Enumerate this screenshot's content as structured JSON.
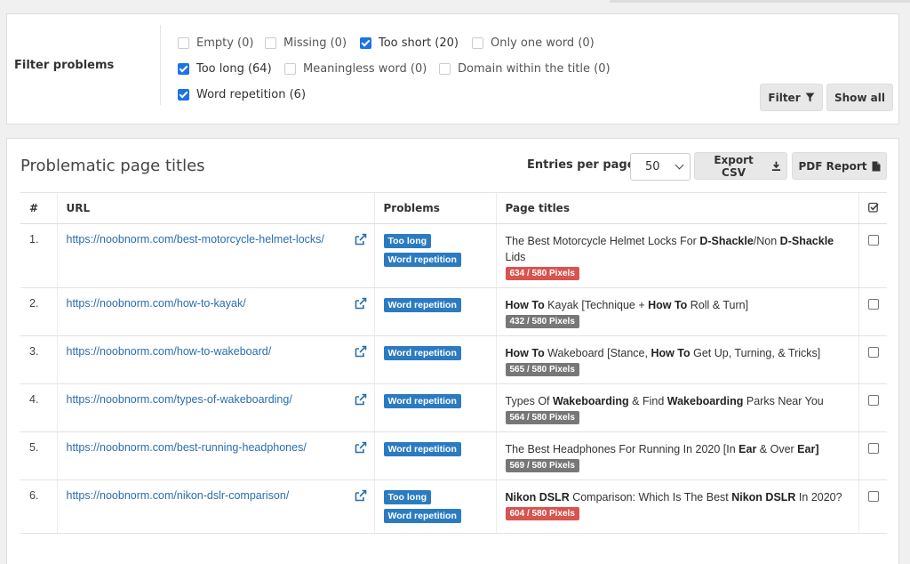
{
  "filter": {
    "title": "Filter problems",
    "options": [
      {
        "label": "Empty (0)",
        "checked": false
      },
      {
        "label": "Missing (0)",
        "checked": false
      },
      {
        "label": "Too short (20)",
        "checked": true
      },
      {
        "label": "Only one word (0)",
        "checked": false
      },
      {
        "label": "Too long (64)",
        "checked": true
      },
      {
        "label": "Meaningless word (0)",
        "checked": false
      },
      {
        "label": "Domain within the title (0)",
        "checked": false
      },
      {
        "label": "Word repetition (6)",
        "checked": true
      }
    ],
    "filter_button": "Filter",
    "show_all_button": "Show all"
  },
  "results": {
    "title": "Problematic page titles",
    "entries_label": "Entries per page:",
    "entries_value": "50",
    "export_csv": "Export CSV",
    "pdf_report": "PDF Report",
    "columns": {
      "num": "#",
      "url": "URL",
      "problems": "Problems",
      "titles": "Page titles"
    },
    "rows": [
      {
        "num": "1.",
        "url": "https://noobnorm.com/best-motorcycle-helmet-locks/",
        "problems": [
          "Too long",
          "Word repetition"
        ],
        "title_parts": [
          {
            "t": "The Best Motorcycle Helmet Locks For ",
            "b": false
          },
          {
            "t": "D-Shackle",
            "b": true
          },
          {
            "t": "/Non ",
            "b": false
          },
          {
            "t": "D-Shackle",
            "b": true
          },
          {
            "t": " Lids",
            "b": false
          }
        ],
        "pixels": "634 / 580 Pixels",
        "over": true
      },
      {
        "num": "2.",
        "url": "https://noobnorm.com/how-to-kayak/",
        "problems": [
          "Word repetition"
        ],
        "title_parts": [
          {
            "t": "How To",
            "b": true
          },
          {
            "t": " Kayak [Technique + ",
            "b": false
          },
          {
            "t": "How To",
            "b": true
          },
          {
            "t": " Roll & Turn]",
            "b": false
          }
        ],
        "pixels": "432 / 580 Pixels",
        "over": false
      },
      {
        "num": "3.",
        "url": "https://noobnorm.com/how-to-wakeboard/",
        "problems": [
          "Word repetition"
        ],
        "title_parts": [
          {
            "t": "How To",
            "b": true
          },
          {
            "t": " Wakeboard [Stance, ",
            "b": false
          },
          {
            "t": "How To",
            "b": true
          },
          {
            "t": " Get Up, Turning, & Tricks]",
            "b": false
          }
        ],
        "pixels": "565 / 580 Pixels",
        "over": false
      },
      {
        "num": "4.",
        "url": "https://noobnorm.com/types-of-wakeboarding/",
        "problems": [
          "Word repetition"
        ],
        "title_parts": [
          {
            "t": "Types Of ",
            "b": false
          },
          {
            "t": "Wakeboarding",
            "b": true
          },
          {
            "t": " & Find ",
            "b": false
          },
          {
            "t": "Wakeboarding",
            "b": true
          },
          {
            "t": " Parks Near You",
            "b": false
          }
        ],
        "pixels": "564 / 580 Pixels",
        "over": false
      },
      {
        "num": "5.",
        "url": "https://noobnorm.com/best-running-headphones/",
        "problems": [
          "Word repetition"
        ],
        "title_parts": [
          {
            "t": "The Best Headphones For Running In 2020 [In ",
            "b": false
          },
          {
            "t": "Ear",
            "b": true
          },
          {
            "t": " & Over ",
            "b": false
          },
          {
            "t": "Ear]",
            "b": true
          }
        ],
        "pixels": "569 / 580 Pixels",
        "over": false
      },
      {
        "num": "6.",
        "url": "https://noobnorm.com/nikon-dslr-comparison/",
        "problems": [
          "Too long",
          "Word repetition"
        ],
        "title_parts": [
          {
            "t": "Nikon DSLR",
            "b": true
          },
          {
            "t": " Comparison: Which Is The Best ",
            "b": false
          },
          {
            "t": "Nikon DSLR",
            "b": true
          },
          {
            "t": " In 2020?",
            "b": false
          }
        ],
        "pixels": "604 / 580 Pixels",
        "over": true
      }
    ]
  },
  "colors": {
    "accent": "#1a73e8",
    "link": "#2a6eb0",
    "badge": "#2b7bc1",
    "over_limit": "#d9534f",
    "within_limit": "#777777"
  }
}
